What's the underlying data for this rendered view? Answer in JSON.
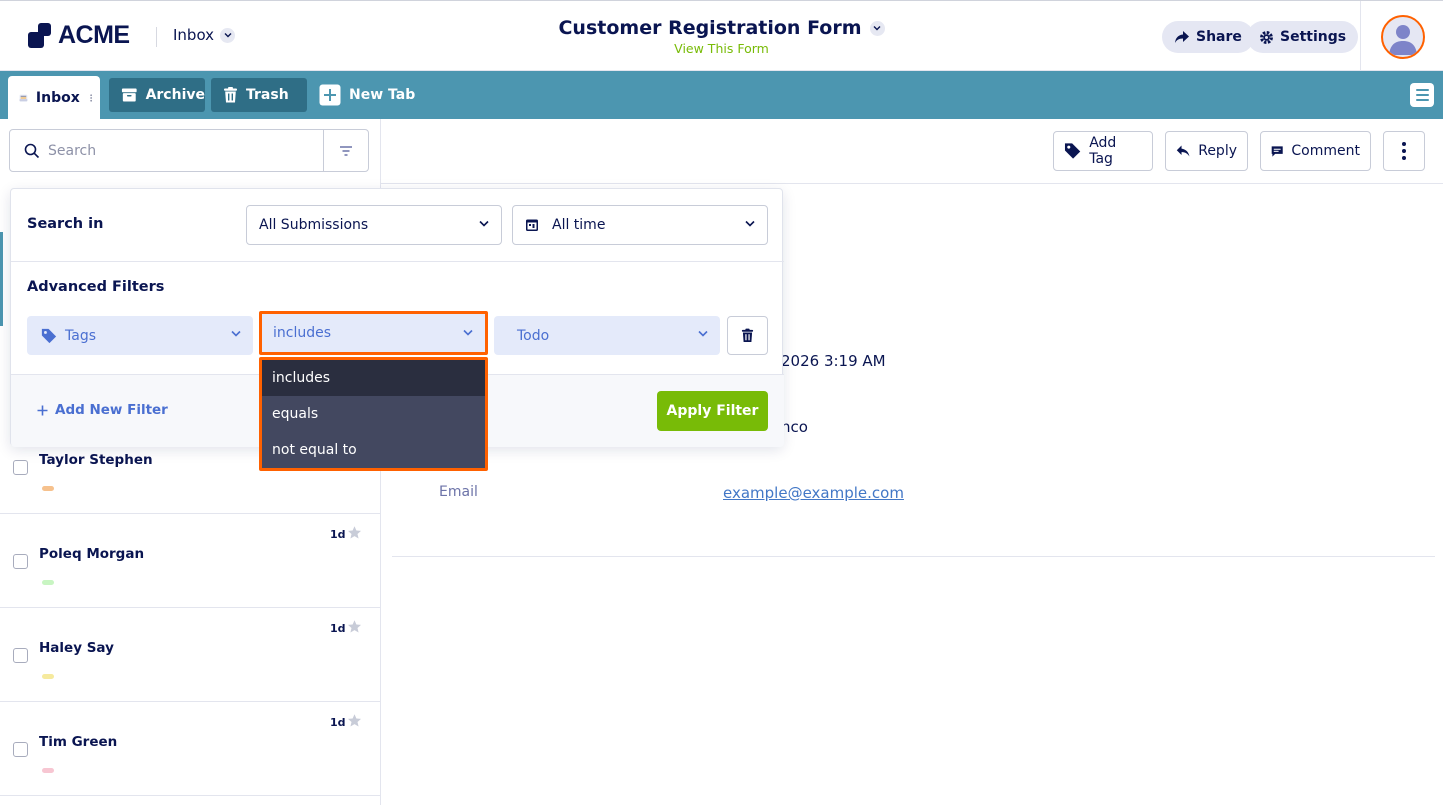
{
  "header": {
    "logo_text": "ACME",
    "inbox_switch": "Inbox",
    "form_title": "Customer Registration Form",
    "view_form": "View This Form",
    "share": "Share",
    "settings": "Settings"
  },
  "tabs": [
    {
      "label": "Inbox"
    },
    {
      "label": "Archive"
    },
    {
      "label": "Trash"
    },
    {
      "label": "New Tab"
    }
  ],
  "search": {
    "placeholder": "Search"
  },
  "toolbar": {
    "add_tag": "Add Tag",
    "reply": "Reply",
    "comment": "Comment"
  },
  "submissions": [
    {
      "name": "Taylor Stephen",
      "age": "",
      "tag_color": "#f6c18d"
    },
    {
      "name": "Poleq Morgan",
      "age": "1d",
      "tag_color": "#c8f5c2"
    },
    {
      "name": "Haley Say",
      "age": "1d",
      "tag_color": "#f6ea9e"
    },
    {
      "name": "Tim Green",
      "age": "1d",
      "tag_color": "#f7c6d2"
    }
  ],
  "detail": {
    "date_fragment": "2026 3:19 AM",
    "city_fragment": "nco",
    "email_label": "Email",
    "email_value": "example@example.com"
  },
  "filter_panel": {
    "search_in_label": "Search in",
    "scope_value": "All Submissions",
    "time_value": "All time",
    "advanced_label": "Advanced Filters",
    "field_value": "Tags",
    "operator_value": "includes",
    "value_value": "Todo",
    "add_filter": "Add New Filter",
    "apply": "Apply Filter",
    "operator_options": [
      "includes",
      "equals",
      "not equal to"
    ]
  },
  "colors": {
    "accent_teal": "#4c96b0",
    "accent_green": "#78bb07",
    "highlight": "#ff6100",
    "navy": "#0a1551"
  }
}
